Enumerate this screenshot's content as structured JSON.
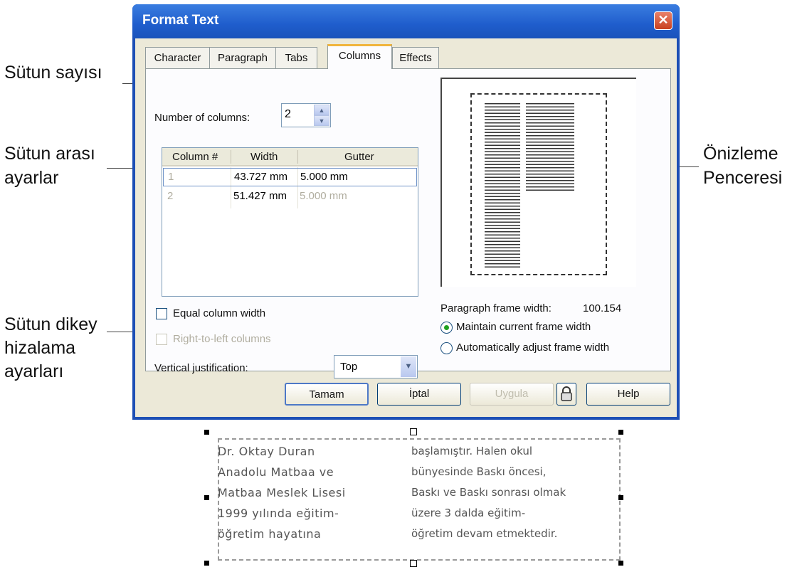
{
  "annotations": {
    "column_count": "Sütun sayısı",
    "column_spacing_line1": "Sütun arası",
    "column_spacing_line2": "ayarlar",
    "vertical_line1": "Sütun dikey",
    "vertical_line2": "hizalama",
    "vertical_line3": "ayarları",
    "preview_line1": "Önizleme",
    "preview_line2": "Penceresi"
  },
  "dialog": {
    "title": "Format Text",
    "close_glyph": "✕",
    "tabs": [
      "Character",
      "Paragraph",
      "Tabs",
      "Columns",
      "Effects"
    ],
    "active_tab": "Columns",
    "number_of_columns_label": "Number of columns:",
    "number_of_columns_value": "2",
    "table": {
      "headers": [
        "Column #",
        "Width",
        "Gutter"
      ],
      "rows": [
        {
          "num": "1",
          "width": "43.727 mm",
          "gutter": "5.000 mm"
        },
        {
          "num": "2",
          "width": "51.427 mm",
          "gutter": "5.000 mm"
        }
      ]
    },
    "equal_column_width": "Equal column width",
    "right_to_left": "Right-to-left columns",
    "vertical_justification_label": "Vertical justification:",
    "vertical_justification_value": "Top",
    "paragraph_frame_width_label": "Paragraph frame width:",
    "paragraph_frame_width_value": "100.154",
    "radio_maintain": "Maintain current frame width",
    "radio_auto": "Automatically adjust frame width",
    "buttons": {
      "ok": "Tamam",
      "cancel": "İptal",
      "apply": "Uygula",
      "help": "Help"
    }
  },
  "sample_text": {
    "col1": [
      "Dr. Oktay Duran",
      "Anadolu Matbaa ve",
      "Matbaa Meslek Lisesi",
      "1999 yılında eğitim-",
      "öğretim hayatına"
    ],
    "col2": [
      "başlamıştır. Halen okul",
      "bünyesinde Baskı öncesi,",
      "Baskı ve Baskı sonrası olmak",
      "üzere 3 dalda eğitim-",
      "öğretim devam etmektedir."
    ]
  }
}
